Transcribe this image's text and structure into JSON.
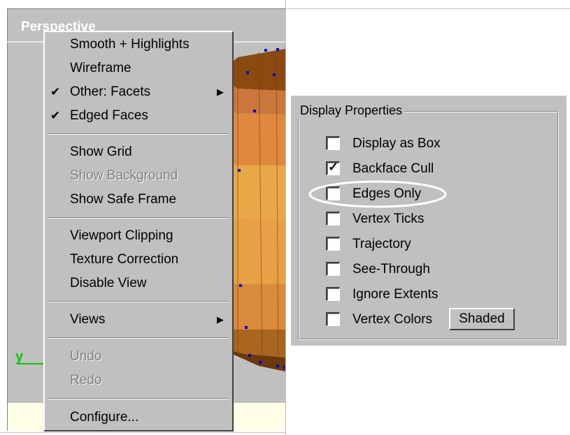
{
  "viewport": {
    "title": "Perspective",
    "axis_label": "y"
  },
  "context_menu": {
    "items": [
      {
        "label": "Smooth + Highlights",
        "checked": false,
        "submenu": false,
        "disabled": false
      },
      {
        "label": "Wireframe",
        "checked": false,
        "submenu": false,
        "disabled": false
      },
      {
        "label": "Other: Facets",
        "checked": true,
        "submenu": true,
        "disabled": false
      },
      {
        "label": "Edged Faces",
        "checked": true,
        "submenu": false,
        "disabled": false
      },
      {
        "label": "Show Grid",
        "checked": false,
        "submenu": false,
        "disabled": false
      },
      {
        "label": "Show Background",
        "checked": false,
        "submenu": false,
        "disabled": true
      },
      {
        "label": "Show Safe Frame",
        "checked": false,
        "submenu": false,
        "disabled": false
      },
      {
        "label": "Viewport Clipping",
        "checked": false,
        "submenu": false,
        "disabled": false
      },
      {
        "label": "Texture Correction",
        "checked": false,
        "submenu": false,
        "disabled": false
      },
      {
        "label": "Disable View",
        "checked": false,
        "submenu": false,
        "disabled": false
      },
      {
        "label": "Views",
        "checked": false,
        "submenu": true,
        "disabled": false
      },
      {
        "label": "Undo",
        "checked": false,
        "submenu": false,
        "disabled": true
      },
      {
        "label": "Redo",
        "checked": false,
        "submenu": false,
        "disabled": true
      },
      {
        "label": "Configure...",
        "checked": false,
        "submenu": false,
        "disabled": false
      }
    ],
    "check_glyph": "✔",
    "arrow_glyph": "▶"
  },
  "display_properties": {
    "title": "Display Properties",
    "options": [
      {
        "label": "Display as Box",
        "checked": false
      },
      {
        "label": "Backface Cull",
        "checked": true
      },
      {
        "label": "Edges Only",
        "checked": false,
        "highlighted": true
      },
      {
        "label": "Vertex Ticks",
        "checked": false
      },
      {
        "label": "Trajectory",
        "checked": false
      },
      {
        "label": "See-Through",
        "checked": false
      },
      {
        "label": "Ignore Extents",
        "checked": false
      },
      {
        "label": "Vertex Colors",
        "checked": false
      }
    ],
    "shaded_button_label": "Shaded",
    "check_glyph": "✓"
  },
  "colors": {
    "viewport_bg": "#c0c0c0",
    "model_dark": "#8b4a10",
    "model_mid": "#c97a3a",
    "model_light": "#e8903c",
    "model_highlight": "#e8a848",
    "vertex_dot": "#0000ee",
    "axis": "#00cc00",
    "highlight_ellipse": "#ffffff"
  }
}
